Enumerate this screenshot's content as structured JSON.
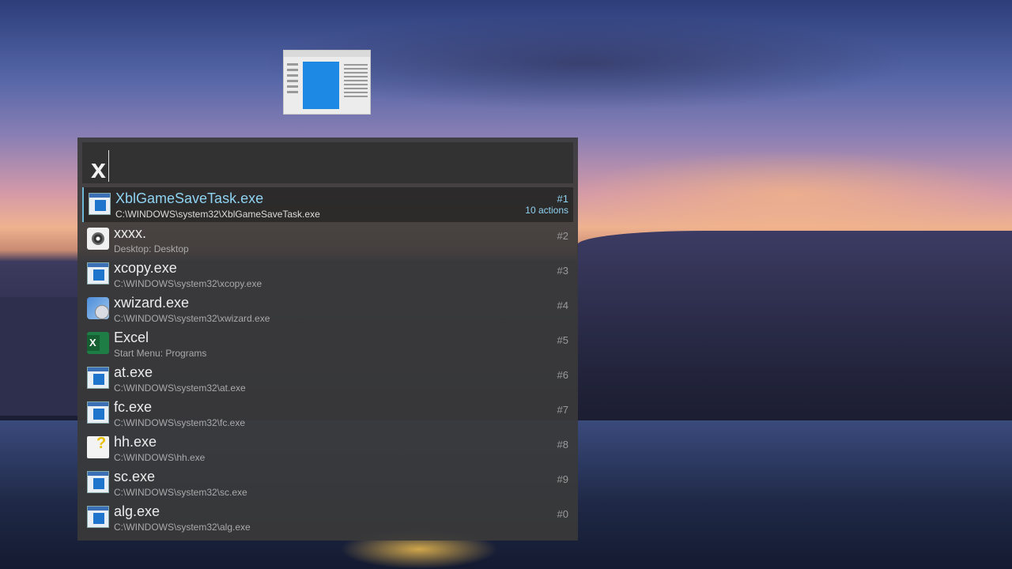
{
  "search": {
    "query": "x"
  },
  "results": [
    {
      "title": "XblGameSaveTask.exe",
      "path": "C:\\WINDOWS\\system32\\XblGameSaveTask.exe",
      "index": "#1",
      "actions": "10 actions",
      "icon": "exe-icon"
    },
    {
      "title": "xxxx.",
      "path": "Desktop: Desktop",
      "index": "#2",
      "icon": "disc-icon"
    },
    {
      "title": "xcopy.exe",
      "path": "C:\\WINDOWS\\system32\\xcopy.exe",
      "index": "#3",
      "icon": "exe-icon"
    },
    {
      "title": "xwizard.exe",
      "path": "C:\\WINDOWS\\system32\\xwizard.exe",
      "index": "#4",
      "icon": "wizard-icon"
    },
    {
      "title": "Excel",
      "path": "Start Menu: Programs",
      "index": "#5",
      "icon": "excel-icon"
    },
    {
      "title": "at.exe",
      "path": "C:\\WINDOWS\\system32\\at.exe",
      "index": "#6",
      "icon": "exe-icon"
    },
    {
      "title": "fc.exe",
      "path": "C:\\WINDOWS\\system32\\fc.exe",
      "index": "#7",
      "icon": "exe-icon"
    },
    {
      "title": "hh.exe",
      "path": "C:\\WINDOWS\\hh.exe",
      "index": "#8",
      "icon": "help-icon"
    },
    {
      "title": "sc.exe",
      "path": "C:\\WINDOWS\\system32\\sc.exe",
      "index": "#9",
      "icon": "exe-icon"
    },
    {
      "title": "alg.exe",
      "path": "C:\\WINDOWS\\system32\\alg.exe",
      "index": "#0",
      "icon": "exe-icon"
    }
  ]
}
